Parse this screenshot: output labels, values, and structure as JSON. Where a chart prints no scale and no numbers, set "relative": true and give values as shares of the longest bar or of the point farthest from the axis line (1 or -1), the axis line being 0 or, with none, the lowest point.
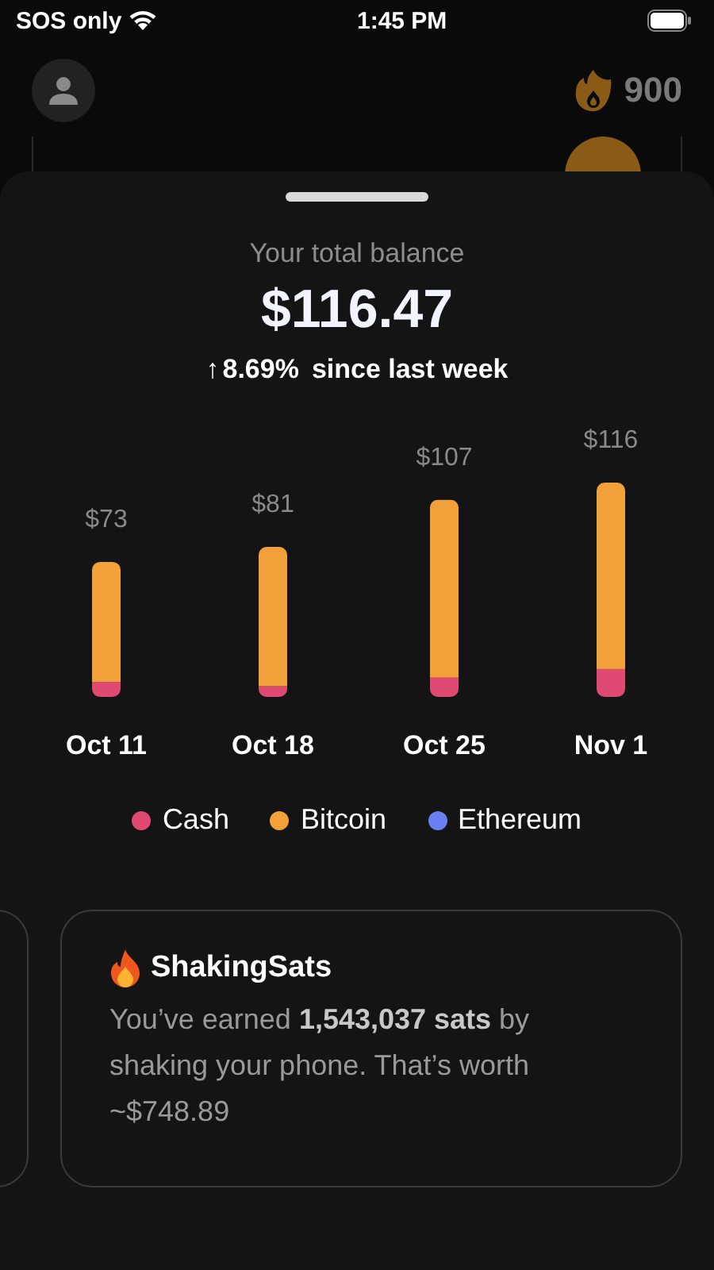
{
  "status_bar": {
    "carrier": "SOS only",
    "time": "1:45 PM"
  },
  "header": {
    "streak": "900"
  },
  "balance": {
    "title": "Your total balance",
    "amount": "$116.47",
    "change": {
      "arrow": "↑",
      "percent": "8.69%",
      "caption": "since last week"
    }
  },
  "chart": {
    "chart_data": {
      "type": "bar",
      "stacked": true,
      "relative": true,
      "categories": [
        "Oct 11",
        "Oct 18",
        "Oct 25",
        "Nov 1"
      ],
      "series": [
        {
          "name": "Cash",
          "color": "#e04a72",
          "values": [
            0.07,
            0.05,
            0.09,
            0.13
          ]
        },
        {
          "name": "Bitcoin",
          "color": "#f2a03a",
          "values": [
            0.56,
            0.65,
            0.83,
            0.87
          ]
        },
        {
          "name": "Ethereum",
          "color": "#6a80f0",
          "values": [
            0,
            0,
            0,
            0
          ]
        }
      ],
      "value_labels": [
        "$73",
        "$81",
        "$107",
        "$116"
      ]
    }
  },
  "cards": [
    {
      "kind": "empty"
    },
    {
      "kind": "info",
      "title": "ShakingSats",
      "text": "You’ve earned **1,543,037 sats** by shaking your phone. That’s worth ~$748.89"
    }
  ]
}
